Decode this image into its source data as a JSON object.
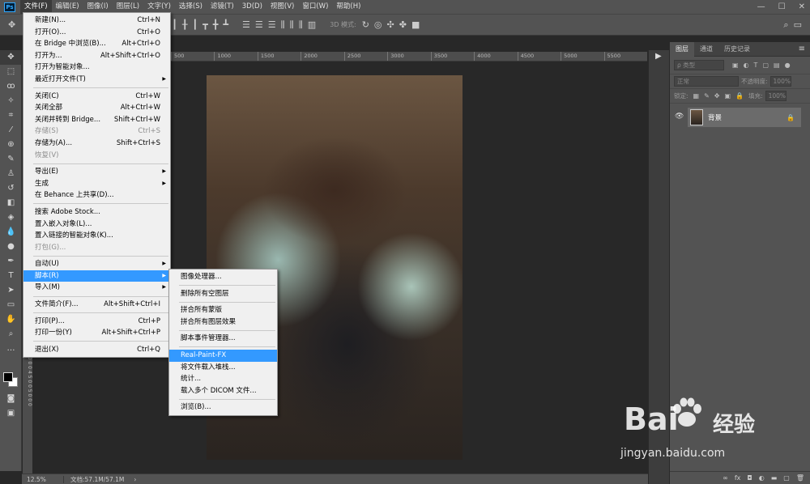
{
  "menubar": {
    "logo": "Ps",
    "items": [
      "文件(F)",
      "编辑(E)",
      "图像(I)",
      "图层(L)",
      "文字(Y)",
      "选择(S)",
      "滤镜(T)",
      "3D(D)",
      "视图(V)",
      "窗口(W)",
      "帮助(H)"
    ],
    "window_controls": [
      "—",
      "☐",
      "✕"
    ]
  },
  "options_bar": {
    "mode_3d": "3D 模式:"
  },
  "ruler": {
    "top_ticks": [
      "500",
      "1000",
      "1500",
      "2000",
      "2500",
      "3000",
      "3500",
      "4000",
      "4500",
      "5000",
      "5500"
    ],
    "left_ticks": "4 0 0 0 4 5 0 0 5 0 0 0"
  },
  "file_menu": [
    {
      "label": "新建(N)...",
      "shortcut": "Ctrl+N"
    },
    {
      "label": "打开(O)...",
      "shortcut": "Ctrl+O"
    },
    {
      "label": "在 Bridge 中浏览(B)...",
      "shortcut": "Alt+Ctrl+O"
    },
    {
      "label": "打开为...",
      "shortcut": "Alt+Shift+Ctrl+O"
    },
    {
      "label": "打开为智能对象...",
      "shortcut": ""
    },
    {
      "label": "最近打开文件(T)",
      "shortcut": "",
      "submenu": true
    },
    {
      "sep": true
    },
    {
      "label": "关闭(C)",
      "shortcut": "Ctrl+W"
    },
    {
      "label": "关闭全部",
      "shortcut": "Alt+Ctrl+W"
    },
    {
      "label": "关闭并转到 Bridge...",
      "shortcut": "Shift+Ctrl+W"
    },
    {
      "label": "存储(S)",
      "shortcut": "Ctrl+S",
      "disabled": true
    },
    {
      "label": "存储为(A)...",
      "shortcut": "Shift+Ctrl+S"
    },
    {
      "label": "恢复(V)",
      "shortcut": "",
      "disabled": true
    },
    {
      "sep": true
    },
    {
      "label": "导出(E)",
      "shortcut": "",
      "submenu": true
    },
    {
      "label": "生成",
      "shortcut": "",
      "submenu": true
    },
    {
      "label": "在 Behance 上共享(D)...",
      "shortcut": ""
    },
    {
      "sep": true
    },
    {
      "label": "搜索 Adobe Stock...",
      "shortcut": ""
    },
    {
      "label": "置入嵌入对象(L)...",
      "shortcut": ""
    },
    {
      "label": "置入链接的智能对象(K)...",
      "shortcut": ""
    },
    {
      "label": "打包(G)...",
      "shortcut": "",
      "disabled": true
    },
    {
      "sep": true
    },
    {
      "label": "自动(U)",
      "shortcut": "",
      "submenu": true
    },
    {
      "label": "脚本(R)",
      "shortcut": "",
      "submenu": true,
      "highlighted": true
    },
    {
      "label": "导入(M)",
      "shortcut": "",
      "submenu": true
    },
    {
      "sep": true
    },
    {
      "label": "文件简介(F)...",
      "shortcut": "Alt+Shift+Ctrl+I"
    },
    {
      "sep": true
    },
    {
      "label": "打印(P)...",
      "shortcut": "Ctrl+P"
    },
    {
      "label": "打印一份(Y)",
      "shortcut": "Alt+Shift+Ctrl+P"
    },
    {
      "sep": true
    },
    {
      "label": "退出(X)",
      "shortcut": "Ctrl+Q"
    }
  ],
  "scripts_submenu": [
    {
      "label": "图像处理器..."
    },
    {
      "sep": true
    },
    {
      "label": "删除所有空图层"
    },
    {
      "sep": true
    },
    {
      "label": "拼合所有蒙版"
    },
    {
      "label": "拼合所有图层效果"
    },
    {
      "sep": true
    },
    {
      "label": "脚本事件管理器..."
    },
    {
      "sep": true
    },
    {
      "label": "Real-Paint-FX",
      "highlighted": true
    },
    {
      "label": "将文件载入堆栈..."
    },
    {
      "label": "统计..."
    },
    {
      "label": "载入多个 DICOM 文件..."
    },
    {
      "sep": true
    },
    {
      "label": "浏览(B)..."
    }
  ],
  "layers_panel": {
    "tabs": [
      "图层",
      "通道",
      "历史记录"
    ],
    "filter_placeholder": "ρ 类型",
    "blend_mode": "正常",
    "opacity_label": "不透明度:",
    "opacity_value": "100%",
    "lock_label": "锁定:",
    "fill_label": "填充:",
    "fill_value": "100%",
    "layer_name": "背景"
  },
  "status": {
    "zoom": "12.5%",
    "doc": "文档:57.1M/57.1M"
  },
  "watermark": {
    "logo_left": "Bai",
    "logo_right": "经验",
    "url": "jingyan.baidu.com"
  }
}
